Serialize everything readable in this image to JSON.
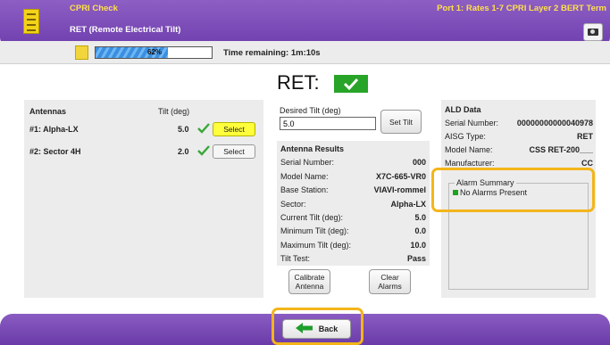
{
  "header": {
    "title": "CPRI Check",
    "subtitle": "RET (Remote Electrical Tilt)",
    "port_info": "Port 1: Rates 1-7 CPRI Layer 2 BERT Term",
    "camera_icon": "camera-icon"
  },
  "status": {
    "progress_percent": 62,
    "progress_text": "62%",
    "time_remaining": "Time remaining: 1m:10s"
  },
  "ret": {
    "label": "RET:",
    "status": "pass"
  },
  "antennas": {
    "header_name": "Antennas",
    "header_tilt": "Tilt (deg)",
    "items": [
      {
        "name": "#1: Alpha-LX",
        "tilt": "5.0",
        "button": "Select",
        "selected": true
      },
      {
        "name": "#2: Sector 4H",
        "tilt": "2.0",
        "button": "Select",
        "selected": false
      }
    ]
  },
  "desired_tilt": {
    "label": "Desired Tilt (deg)",
    "value": "5.0",
    "set_label": "Set Tilt"
  },
  "results": {
    "title": "Antenna Results",
    "rows": [
      {
        "k": "Serial Number:",
        "v": "000"
      },
      {
        "k": "Model Name:",
        "v": "X7C-665-VR0"
      },
      {
        "k": "Base Station:",
        "v": "VIAVI-rommel"
      },
      {
        "k": "Sector:",
        "v": "Alpha-LX"
      },
      {
        "k": "Current Tilt (deg):",
        "v": "5.0"
      },
      {
        "k": "Minimum Tilt (deg):",
        "v": "0.0"
      },
      {
        "k": "Maximum Tilt (deg):",
        "v": "10.0"
      },
      {
        "k": "Tilt Test:",
        "v": "Pass"
      }
    ]
  },
  "buttons": {
    "calibrate": "Calibrate Antenna",
    "clear": "Clear Alarms",
    "back": "Back"
  },
  "ald": {
    "title": "ALD Data",
    "rows": [
      {
        "k": "Serial Number:",
        "v": "00000000000040978"
      },
      {
        "k": "AISG Type:",
        "v": "RET"
      },
      {
        "k": "Model Name:",
        "v": "CSS RET-200___"
      },
      {
        "k": "Manufacturer:",
        "v": "CC"
      }
    ],
    "alarm_title": "Alarm Summary",
    "alarm_item": "No Alarms Present"
  },
  "colors": {
    "accent": "#7a4cb8",
    "pass": "#28a428",
    "highlight": "#f3b51a",
    "select_active": "#ffff3c"
  }
}
